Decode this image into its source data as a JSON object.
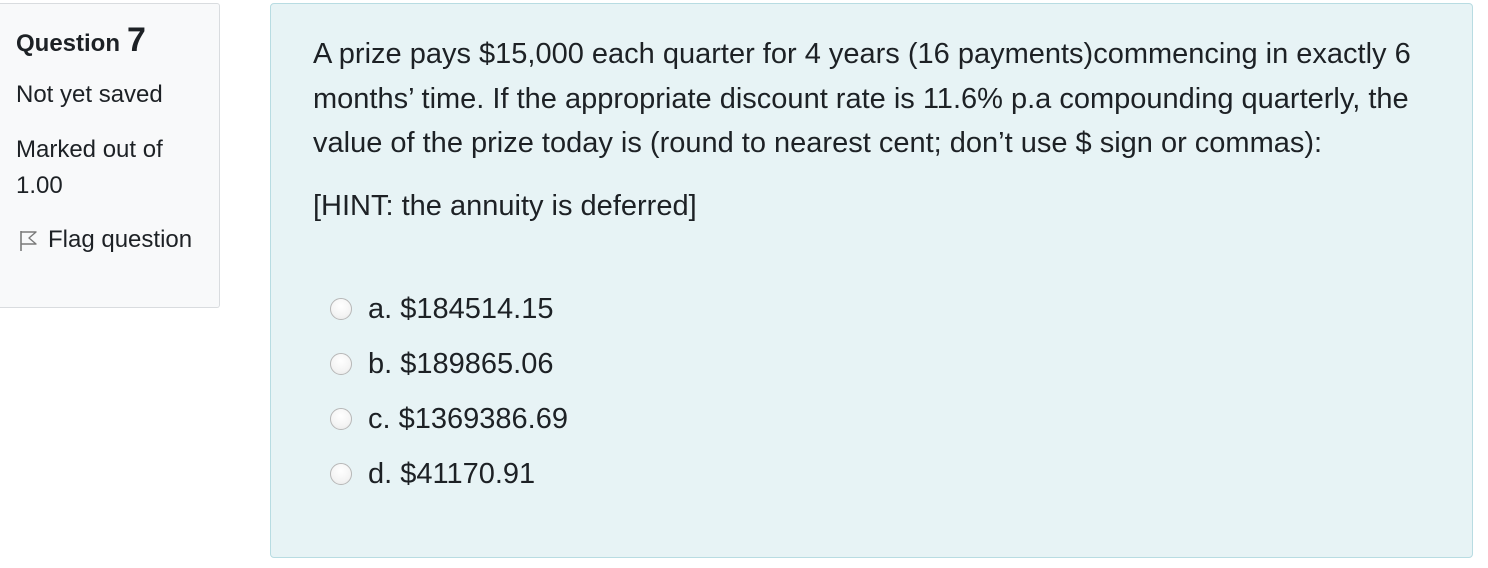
{
  "info": {
    "question_word": "Question",
    "question_number": "7",
    "state": "Not yet saved",
    "grade": "Marked out of 1.00",
    "flag_label": "Flag question",
    "flag_icon": "flag-icon"
  },
  "question": {
    "text": "A prize pays $15,000 each quarter for 4 years (16 payments)commencing in exactly 6 months’ time. If the appropriate discount rate is 11.6% p.a compounding quarterly, the value of the prize today is (round to nearest cent; don’t use $ sign or commas):",
    "hint": "[HINT: the annuity is deferred]"
  },
  "answers": [
    {
      "label": "a. $184514.15",
      "selected": false
    },
    {
      "label": "b. $189865.06",
      "selected": false
    },
    {
      "label": "c. $1369386.69",
      "selected": false
    },
    {
      "label": "d. $41170.91",
      "selected": false
    }
  ]
}
